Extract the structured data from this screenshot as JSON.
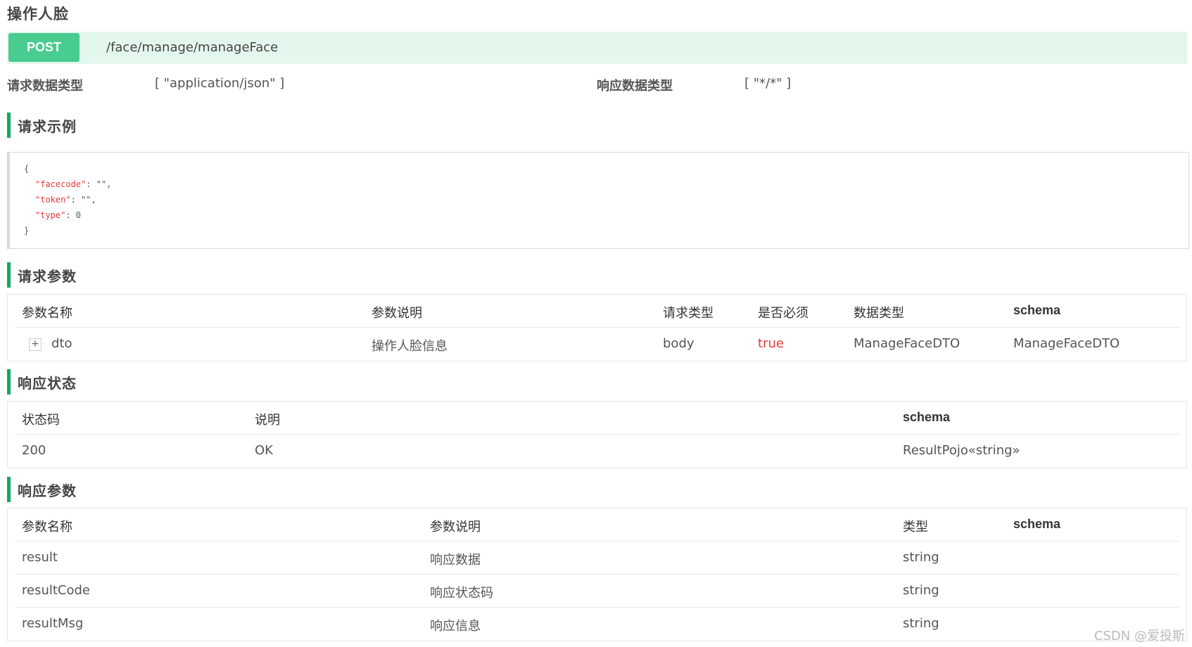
{
  "api": {
    "title": "操作人脸",
    "method": "POST",
    "path": "/face/manage/manageFace",
    "request_type_label": "请求数据类型",
    "request_type_value": "[ \"application/json\" ]",
    "response_type_label": "响应数据类型",
    "response_type_value": "[ \"*/*\" ]"
  },
  "sections": {
    "example": "请求示例",
    "params": "请求参数",
    "status": "响应状态",
    "response_params": "响应参数"
  },
  "example_code": {
    "open": "{",
    "l1_key": "\"facecode\"",
    "l1_rest": ": \"\",",
    "l2_key": "\"token\"",
    "l2_rest": ": \"\",",
    "l3_key": "\"type\"",
    "l3_rest": ": 0",
    "close": "}"
  },
  "params_table": {
    "headers": [
      "参数名称",
      "参数说明",
      "请求类型",
      "是否必须",
      "数据类型",
      "schema"
    ],
    "rows": [
      {
        "expand": "+",
        "name": "dto",
        "desc": "操作人脸信息",
        "in": "body",
        "required": "true",
        "type": "ManageFaceDTO",
        "schema": "ManageFaceDTO"
      }
    ]
  },
  "status_table": {
    "headers": [
      "状态码",
      "说明",
      "schema"
    ],
    "rows": [
      {
        "code": "200",
        "desc": "OK",
        "schema": "ResultPojo«string»"
      }
    ]
  },
  "response_table": {
    "headers": [
      "参数名称",
      "参数说明",
      "类型",
      "schema"
    ],
    "rows": [
      {
        "name": "result",
        "desc": "响应数据",
        "type": "string",
        "schema": ""
      },
      {
        "name": "resultCode",
        "desc": "响应状态码",
        "type": "string",
        "schema": ""
      },
      {
        "name": "resultMsg",
        "desc": "响应信息",
        "type": "string",
        "schema": ""
      }
    ]
  },
  "watermark": "CSDN @爱投斯",
  "colors": {
    "method_badge": "#49cc90",
    "path_bar": "#e4f7ed",
    "section_accent": "#10a861",
    "required_true": "#e53a3a"
  }
}
